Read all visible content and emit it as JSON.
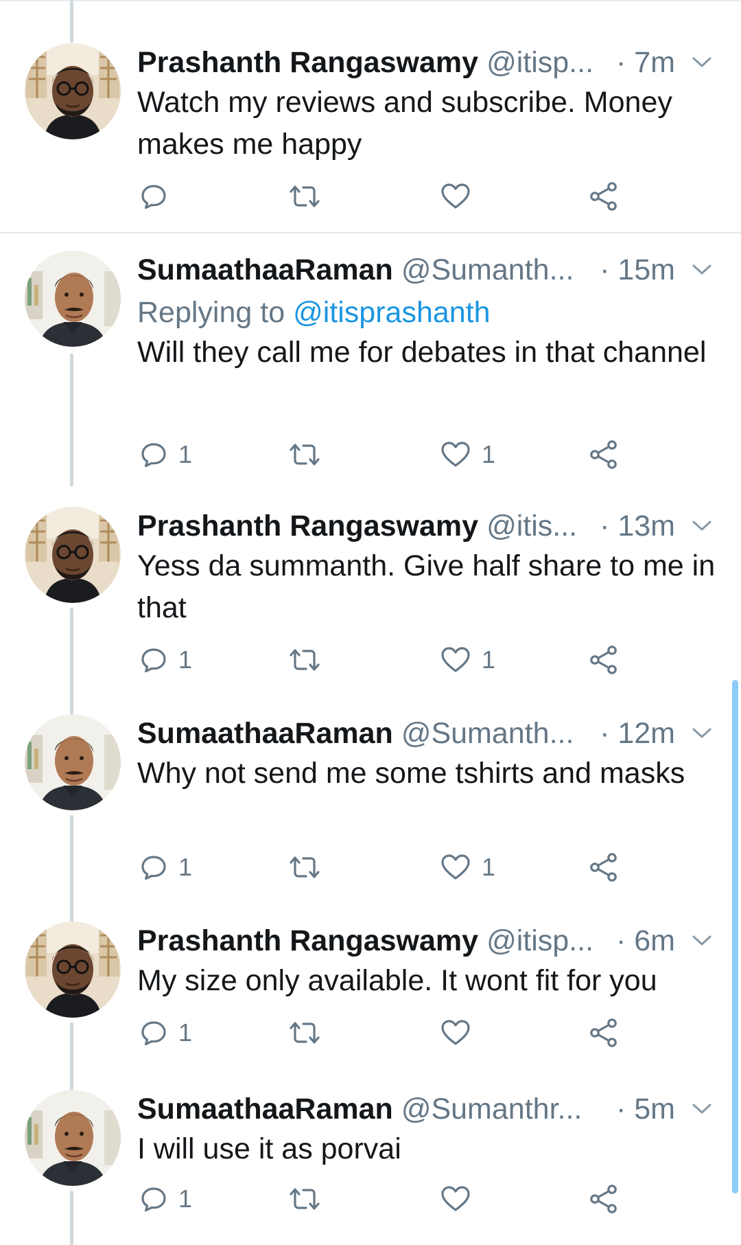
{
  "tweets": [
    {
      "author": "Prashanth Rangaswamy",
      "handle": "@itisp...",
      "time": "· 7m",
      "replying_prefix": "",
      "replying_to": "",
      "text": "Watch my reviews and subscribe.  Money makes me happy",
      "reply_count": "",
      "like_count": "",
      "avatar": "prashanth"
    },
    {
      "author": "SumaathaaRaman",
      "handle": "@Sumanth...",
      "time": "· 15m",
      "replying_prefix": "Replying to",
      "replying_to": "@itisprashanth",
      "text": "Will they call me for debates in that channel",
      "reply_count": "1",
      "like_count": "1",
      "avatar": "sumanth"
    },
    {
      "author": "Prashanth Rangaswamy",
      "handle": "@itis...",
      "time": "· 13m",
      "replying_prefix": "",
      "replying_to": "",
      "text": "Yess da summanth. Give half share to me in that",
      "reply_count": "1",
      "like_count": "1",
      "avatar": "prashanth"
    },
    {
      "author": "SumaathaaRaman",
      "handle": "@Sumanth...",
      "time": "· 12m",
      "replying_prefix": "",
      "replying_to": "",
      "text": "Why not send me some tshirts and masks",
      "reply_count": "1",
      "like_count": "1",
      "avatar": "sumanth"
    },
    {
      "author": "Prashanth Rangaswamy",
      "handle": "@itisp...",
      "time": "· 6m",
      "replying_prefix": "",
      "replying_to": "",
      "text": "My size only available. It wont fit for you",
      "reply_count": "1",
      "like_count": "",
      "avatar": "prashanth"
    },
    {
      "author": "SumaathaaRaman",
      "handle": "@Sumanthr...",
      "time": "· 5m",
      "replying_prefix": "",
      "replying_to": "",
      "text": "I will use it as porvai",
      "reply_count": "1",
      "like_count": "",
      "avatar": "sumanth"
    }
  ],
  "icons": {
    "reply": "reply-icon",
    "retweet": "retweet-icon",
    "like": "heart-icon",
    "share": "share-icon",
    "caret": "chevron-down-icon"
  },
  "colors": {
    "text": "#14171a",
    "muted": "#657786",
    "link": "#1b95e0",
    "thread_line": "#cfd9de",
    "scrollbar": "#8ecdf7"
  }
}
